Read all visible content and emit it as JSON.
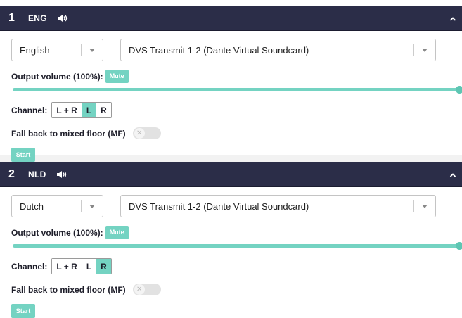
{
  "colors": {
    "header_bg": "#2b2d48",
    "accent": "#74d3c2",
    "text": "#1e1e2a"
  },
  "panels": [
    {
      "number": "1",
      "lang_code": "ENG",
      "language": "English",
      "device": "DVS Transmit 1-2 (Dante Virtual Soundcard)",
      "volume_label": "Output volume (100%):",
      "volume_value": 100,
      "mute_label": "Mute",
      "channel_label": "Channel:",
      "channels": [
        "L + R",
        "L",
        "R"
      ],
      "selected_channel": "L",
      "fallback_label": "Fall back to mixed floor (MF)",
      "fallback_enabled": false,
      "start_label": "Start"
    },
    {
      "number": "2",
      "lang_code": "NLD",
      "language": "Dutch",
      "device": "DVS Transmit 1-2 (Dante Virtual Soundcard)",
      "volume_label": "Output volume (100%):",
      "volume_value": 100,
      "mute_label": "Mute",
      "channel_label": "Channel:",
      "channels": [
        "L + R",
        "L",
        "R"
      ],
      "selected_channel": "R",
      "fallback_label": "Fall back to mixed floor (MF)",
      "fallback_enabled": false,
      "start_label": "Start"
    }
  ],
  "icons": {
    "speaker": "speaker-icon",
    "collapse": "chevron-up-icon",
    "dropdown": "caret-down-icon",
    "toggle_off": "x-icon"
  }
}
